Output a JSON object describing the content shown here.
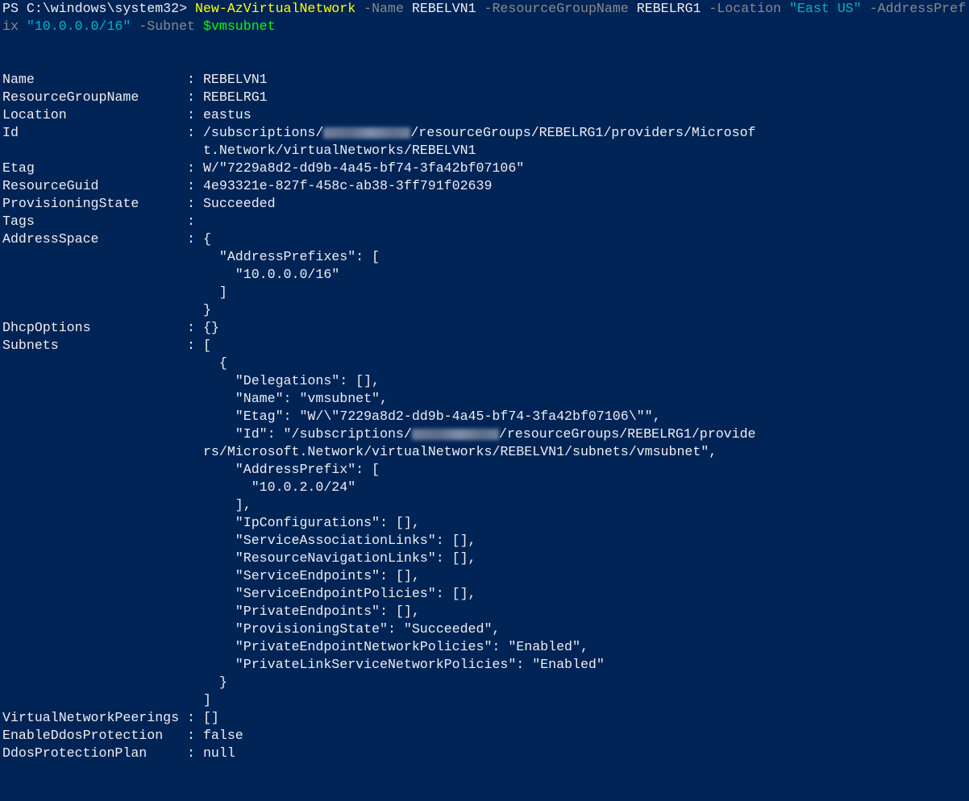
{
  "terminal": {
    "prompt": "PS C:\\windows\\system32> ",
    "command": {
      "cmdlet": "New-AzVirtualNetwork",
      "p_name": " -Name ",
      "v_name": "REBELVN1",
      "p_rg": " -ResourceGroupName ",
      "v_rg": "REBELRG1",
      "p_loc": " -Location ",
      "v_loc": "\"East US\"",
      "p_addr1": " -AddressPref",
      "p_addr2": "ix",
      "v_addr": " \"10.0.0.0/16\"",
      "p_subnet": " -Subnet ",
      "v_subnet": "$vmsubnet"
    },
    "output": {
      "name": "Name                   : REBELVN1",
      "rgname": "ResourceGroupName      : REBELRG1",
      "location": "Location               : eastus",
      "id_a": "Id                     : /subscriptions/",
      "id_b": "/resourceGroups/REBELRG1/providers/Microsof",
      "id_c": "                         t.Network/virtualNetworks/REBELVN1",
      "etag": "Etag                   : W/\"7229a8d2-dd9b-4a45-bf74-3fa42bf07106\"",
      "guid": "ResourceGuid           : 4e93321e-827f-458c-ab38-3ff791f02639",
      "prov": "ProvisioningState      : Succeeded",
      "tags": "Tags                   :",
      "as1": "AddressSpace           : {",
      "as2": "                           \"AddressPrefixes\": [",
      "as3": "                             \"10.0.0.0/16\"",
      "as4": "                           ]",
      "as5": "                         }",
      "dhcp": "DhcpOptions            : {}",
      "sn1": "Subnets                : [",
      "sn2": "                           {",
      "sn3": "                             \"Delegations\": [],",
      "sn4": "                             \"Name\": \"vmsubnet\",",
      "sn5": "                             \"Etag\": \"W/\\\"7229a8d2-dd9b-4a45-bf74-3fa42bf07106\\\"\",",
      "sn6a": "                             \"Id\": \"/subscriptions/",
      "sn6b": "/resourceGroups/REBELRG1/provide",
      "sn7": "                         rs/Microsoft.Network/virtualNetworks/REBELVN1/subnets/vmsubnet\",",
      "sn8": "                             \"AddressPrefix\": [",
      "sn9": "                               \"10.0.2.0/24\"",
      "sn10": "                             ],",
      "sn11": "                             \"IpConfigurations\": [],",
      "sn12": "                             \"ServiceAssociationLinks\": [],",
      "sn13": "                             \"ResourceNavigationLinks\": [],",
      "sn14": "                             \"ServiceEndpoints\": [],",
      "sn15": "                             \"ServiceEndpointPolicies\": [],",
      "sn16": "                             \"PrivateEndpoints\": [],",
      "sn17": "                             \"ProvisioningState\": \"Succeeded\",",
      "sn18": "                             \"PrivateEndpointNetworkPolicies\": \"Enabled\",",
      "sn19": "                             \"PrivateLinkServiceNetworkPolicies\": \"Enabled\"",
      "sn20": "                           }",
      "sn21": "                         ]",
      "peer": "VirtualNetworkPeerings : []",
      "ddos": "EnableDdosProtection   : false",
      "ddosplan": "DdosProtectionPlan     : null"
    },
    "colors": {
      "background": "#012456",
      "foreground": "#eeedf0",
      "cmdlet": "#ffff00",
      "parameter": "#8a8a8a",
      "string": "#00b4d2",
      "variable": "#00ff00"
    }
  }
}
